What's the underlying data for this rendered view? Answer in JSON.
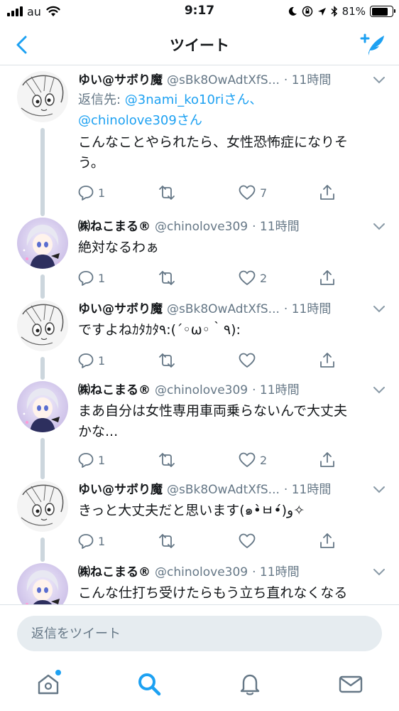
{
  "status_bar": {
    "carrier": "au",
    "time": "9:17",
    "battery_percent": "81%",
    "battery_level": 0.81,
    "icons": [
      "signal-icon",
      "wifi-icon",
      "moon-icon",
      "rotation-lock-icon",
      "location-icon",
      "bluetooth-icon",
      "battery-icon"
    ]
  },
  "nav": {
    "title": "ツイート",
    "back_icon": "chevron-left-icon",
    "compose_icon": "compose-tweet-icon"
  },
  "tweets": [
    {
      "name": "ゆい@サボり魔",
      "handle": "@sBk8OwAdtXfS...",
      "time": "· 11時間",
      "reply_prefix": "返信先: ",
      "reply_mention_1": "@3nami_ko10riさん、",
      "reply_mention_2": "@chinolove309さん",
      "text_line1": "こんなことやられたら、女性恐怖症になりそ",
      "text_line2": "う。",
      "replies": "1",
      "retweets": "",
      "likes": "7"
    },
    {
      "name": "㈱ねこまる®",
      "handle": "@chinolove309",
      "time": "· 11時間",
      "text_line1": "絶対なるわぁ",
      "replies": "1",
      "retweets": "",
      "likes": "2"
    },
    {
      "name": "ゆい@サボり魔",
      "handle": "@sBk8OwAdtXfS...",
      "time": "· 11時間",
      "text_line1": "ですよねｶﾀｶﾀ٩:(´◦ω◦｀٩):",
      "replies": "1",
      "retweets": "",
      "likes": ""
    },
    {
      "name": "㈱ねこまる®",
      "handle": "@chinolove309",
      "time": "· 11時間",
      "text_line1": "まあ自分は女性専用車両乗らないんで大丈夫",
      "text_line2": "かな...",
      "replies": "1",
      "retweets": "",
      "likes": "2"
    },
    {
      "name": "ゆい@サボり魔",
      "handle": "@sBk8OwAdtXfS...",
      "time": "· 11時間",
      "text_line1": "きっと大丈夫だと思います(๑•̀ㅂ•́)و✧",
      "replies": "1",
      "retweets": "",
      "likes": ""
    },
    {
      "name": "㈱ねこまる®",
      "handle": "@chinolove309",
      "time": "· 11時間",
      "text_line1": "こんな仕打ち受けたらもう立ち直れなくなる"
    }
  ],
  "reply_bar": {
    "placeholder": "返信をツイート"
  },
  "tab_bar": {
    "items": [
      "home-icon",
      "search-icon",
      "notifications-icon",
      "messages-icon"
    ],
    "accent": "#1da1f2",
    "inactive": "#657786"
  },
  "colors": {
    "accent": "#1da1f2",
    "text": "#14171a",
    "secondary": "#657786",
    "thread_line": "#ccd6dd",
    "divider": "#dbe1e6",
    "input_bg": "#e6ecf0"
  }
}
